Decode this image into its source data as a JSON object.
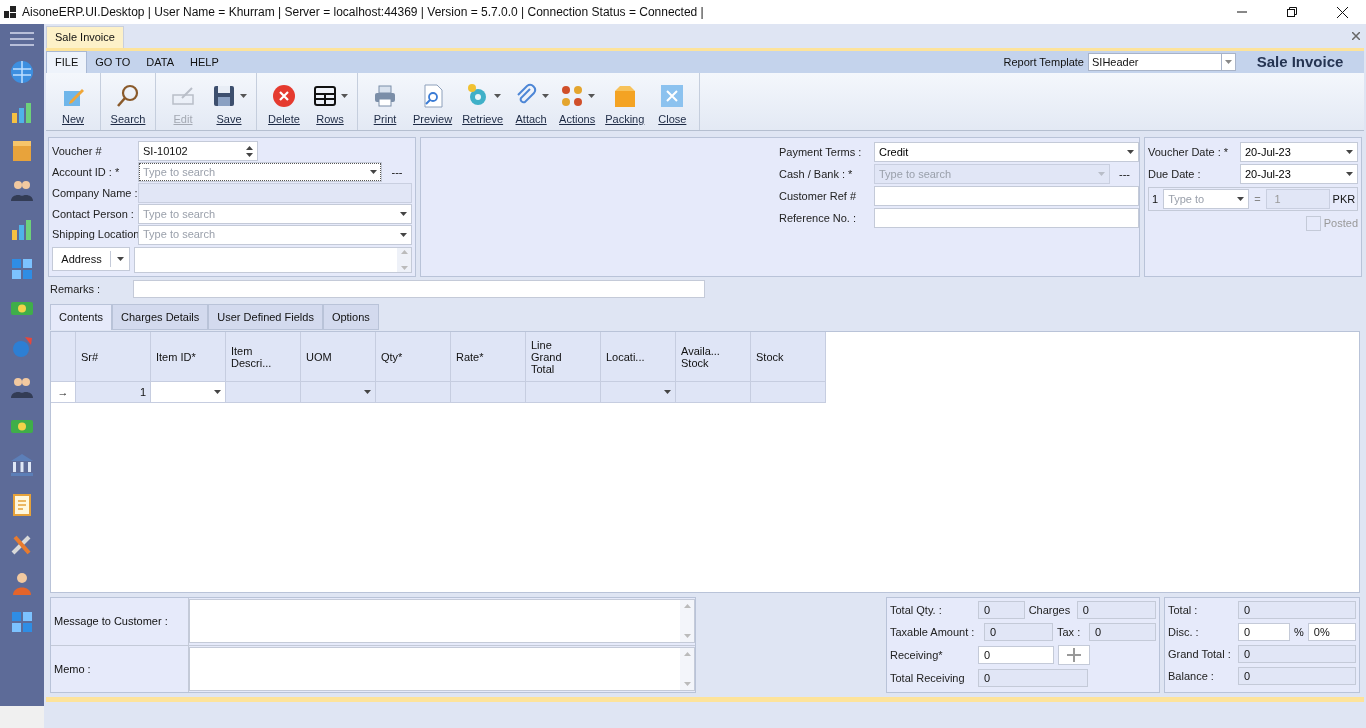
{
  "window": {
    "title": "AisoneERP.UI.Desktop | User Name = Khurram | Server = localhost:44369 | Version = 5.7.0.0 | Connection Status = Connected |"
  },
  "document_tab": {
    "label": "Sale Invoice",
    "selected": true
  },
  "ribbon": {
    "menus": [
      {
        "label": "FILE",
        "selected": true
      },
      {
        "label": "GO TO",
        "selected": false
      },
      {
        "label": "DATA",
        "selected": false
      },
      {
        "label": "HELP",
        "selected": false
      }
    ],
    "report_template": {
      "label": "Report Template",
      "value": "SIHeader"
    },
    "form_title": "Sale Invoice",
    "button_groups": [
      [
        {
          "label": "New",
          "disabled": false,
          "dropdown": false
        }
      ],
      [
        {
          "label": "Search",
          "disabled": false,
          "dropdown": false
        }
      ],
      [
        {
          "label": "Edit",
          "disabled": true,
          "dropdown": false
        },
        {
          "label": "Save",
          "disabled": false,
          "dropdown": true
        }
      ],
      [
        {
          "label": "Delete",
          "disabled": false,
          "dropdown": false
        },
        {
          "label": "Rows",
          "disabled": false,
          "dropdown": true
        }
      ],
      [
        {
          "label": "Print",
          "disabled": false,
          "dropdown": false
        },
        {
          "label": "Preview",
          "disabled": false,
          "dropdown": false
        },
        {
          "label": "Retrieve",
          "disabled": false,
          "dropdown": true
        },
        {
          "label": "Attach",
          "disabled": false,
          "dropdown": true
        },
        {
          "label": "Actions",
          "disabled": false,
          "dropdown": true
        },
        {
          "label": "Packing",
          "disabled": false,
          "dropdown": false
        },
        {
          "label": "Close",
          "disabled": false,
          "dropdown": false
        }
      ]
    ]
  },
  "header_left": [
    {
      "kind": "spin",
      "label": "Voucher #",
      "value": "SI-10102"
    },
    {
      "kind": "combo",
      "label": "Account ID : *",
      "placeholder": "Type to search",
      "focused": true,
      "suffix": "---"
    },
    {
      "kind": "readonly",
      "label": "Company Name :"
    },
    {
      "kind": "combo",
      "label": "Contact Person :",
      "placeholder": "Type to search",
      "focused": false
    },
    {
      "kind": "combo",
      "label": "Shipping Location",
      "placeholder": "Type to search",
      "focused": false
    },
    {
      "kind": "address",
      "button": "Address"
    }
  ],
  "header_middle": [
    {
      "kind": "combo",
      "label": "Payment Terms :",
      "value": "Credit",
      "disabled": false
    },
    {
      "kind": "combo",
      "label": "Cash / Bank : *",
      "placeholder": "Type to search",
      "disabled": true,
      "suffix": "---"
    },
    {
      "kind": "text",
      "label": "Customer Ref #"
    },
    {
      "kind": "text",
      "label": "Reference No. :"
    }
  ],
  "header_right": {
    "dates": [
      {
        "label": "Voucher Date : *",
        "value": "20-Jul-23"
      },
      {
        "label": "Due Date :",
        "value": "20-Jul-23"
      }
    ],
    "currency": {
      "rate": "1",
      "placeholder": "Type to",
      "equals": "=",
      "value": "1",
      "code": "PKR"
    },
    "posted": {
      "label": "Posted",
      "checked": false,
      "disabled": true
    }
  },
  "remarks": {
    "label": "Remarks :"
  },
  "tabs": [
    {
      "label": "Contents",
      "selected": true
    },
    {
      "label": "Charges Details",
      "selected": false
    },
    {
      "label": "User Defined Fields",
      "selected": false
    },
    {
      "label": "Options",
      "selected": false
    }
  ],
  "table": {
    "columns": [
      {
        "label": "Sr#",
        "dropdown": false
      },
      {
        "label": "Item ID*",
        "dropdown": true
      },
      {
        "label": "Item\nDescri...",
        "dropdown": false
      },
      {
        "label": "UOM",
        "dropdown": true
      },
      {
        "label": "Qty*",
        "dropdown": false
      },
      {
        "label": "Rate*",
        "dropdown": false
      },
      {
        "label": "Line\nGrand\nTotal",
        "dropdown": false
      },
      {
        "label": "Locati...",
        "dropdown": true
      },
      {
        "label": "Availa...\nStock",
        "dropdown": false
      },
      {
        "label": "Stock",
        "dropdown": false
      }
    ],
    "rows": [
      {
        "indicator": "→",
        "sr": "1"
      }
    ]
  },
  "notes": [
    {
      "label": "Message to Customer :"
    },
    {
      "label": "Memo :"
    }
  ],
  "totals": {
    "total_qty": {
      "label": "Total Qty. :",
      "value": "0"
    },
    "charges": {
      "label": "Charges",
      "value": "0"
    },
    "taxable_amount": {
      "label": "Taxable Amount :",
      "value": "0"
    },
    "tax": {
      "label": "Tax :",
      "value": "0"
    },
    "receiving": {
      "label": "Receiving*",
      "value": "0"
    },
    "total_receiving": {
      "label": "Total Receiving",
      "value": "0"
    }
  },
  "summary": {
    "total": {
      "label": "Total :",
      "value": "0"
    },
    "disc": {
      "label": "Disc. :",
      "value": "0",
      "percent_sign": "%",
      "percent": "0%"
    },
    "grand_total": {
      "label": "Grand Total :",
      "value": "0"
    },
    "balance": {
      "label": "Balance :",
      "value": "0"
    }
  }
}
